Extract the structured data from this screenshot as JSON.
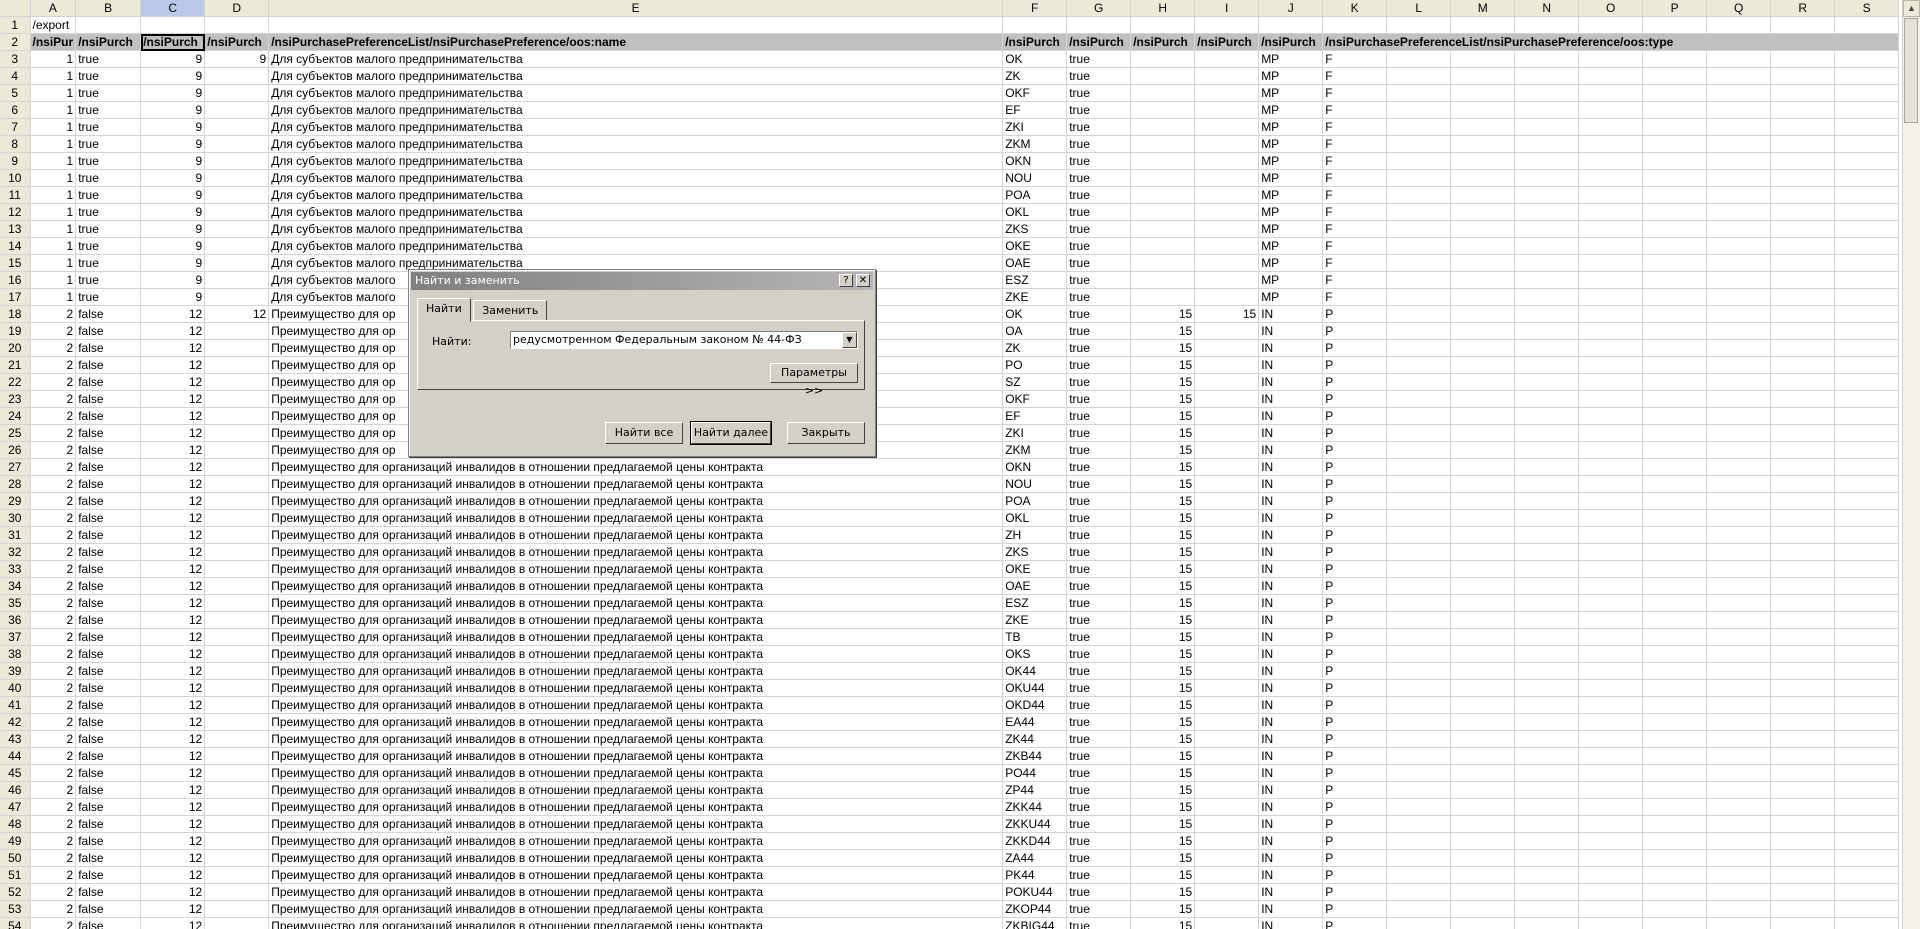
{
  "columns": [
    "A",
    "B",
    "C",
    "D",
    "E",
    "F",
    "G",
    "H",
    "I",
    "J",
    "K",
    "L",
    "M",
    "N",
    "O",
    "P",
    "Q",
    "R",
    "S"
  ],
  "active_column": "C",
  "row1": {
    "a": "/export"
  },
  "row2": {
    "a": "/nsiPur",
    "b": "/nsiPurch",
    "c": "/nsiPurch",
    "d": "/nsiPurch",
    "e": "/nsiPurchasePreferenceList/nsiPurchasePreference/oos:name",
    "f": "/nsiPurch",
    "g": "/nsiPurch",
    "h": "/nsiPurch",
    "i": "/nsiPurch",
    "j": "/nsiPurch",
    "k": "/nsiPurchasePreferenceList/nsiPurchasePreference/oos:type"
  },
  "text_mp": "Для субъектов малого предпринимательства",
  "text_mp_cut": "Для субъектов малого",
  "text_in": "Преимущество для организаций инвалидов в отношении предлагаемой цены контракта",
  "text_in_cut": "Преимущество для ор",
  "rows": [
    {
      "n": "3",
      "a": "1",
      "b": "true",
      "c": "9",
      "d": "9",
      "f": "OK",
      "g": "true",
      "h": "",
      "i": "",
      "j": "MP",
      "k": "F"
    },
    {
      "n": "4",
      "a": "1",
      "b": "true",
      "c": "9",
      "d": "",
      "f": "ZK",
      "g": "true",
      "h": "",
      "i": "",
      "j": "MP",
      "k": "F"
    },
    {
      "n": "5",
      "a": "1",
      "b": "true",
      "c": "9",
      "d": "",
      "f": "OKF",
      "g": "true",
      "h": "",
      "i": "",
      "j": "MP",
      "k": "F"
    },
    {
      "n": "6",
      "a": "1",
      "b": "true",
      "c": "9",
      "d": "",
      "f": "EF",
      "g": "true",
      "h": "",
      "i": "",
      "j": "MP",
      "k": "F"
    },
    {
      "n": "7",
      "a": "1",
      "b": "true",
      "c": "9",
      "d": "",
      "f": "ZKI",
      "g": "true",
      "h": "",
      "i": "",
      "j": "MP",
      "k": "F"
    },
    {
      "n": "8",
      "a": "1",
      "b": "true",
      "c": "9",
      "d": "",
      "f": "ZKM",
      "g": "true",
      "h": "",
      "i": "",
      "j": "MP",
      "k": "F"
    },
    {
      "n": "9",
      "a": "1",
      "b": "true",
      "c": "9",
      "d": "",
      "f": "OKN",
      "g": "true",
      "h": "",
      "i": "",
      "j": "MP",
      "k": "F"
    },
    {
      "n": "10",
      "a": "1",
      "b": "true",
      "c": "9",
      "d": "",
      "f": "NOU",
      "g": "true",
      "h": "",
      "i": "",
      "j": "MP",
      "k": "F"
    },
    {
      "n": "11",
      "a": "1",
      "b": "true",
      "c": "9",
      "d": "",
      "f": "POA",
      "g": "true",
      "h": "",
      "i": "",
      "j": "MP",
      "k": "F"
    },
    {
      "n": "12",
      "a": "1",
      "b": "true",
      "c": "9",
      "d": "",
      "f": "OKL",
      "g": "true",
      "h": "",
      "i": "",
      "j": "MP",
      "k": "F"
    },
    {
      "n": "13",
      "a": "1",
      "b": "true",
      "c": "9",
      "d": "",
      "f": "ZKS",
      "g": "true",
      "h": "",
      "i": "",
      "j": "MP",
      "k": "F"
    },
    {
      "n": "14",
      "a": "1",
      "b": "true",
      "c": "9",
      "d": "",
      "f": "OKE",
      "g": "true",
      "h": "",
      "i": "",
      "j": "MP",
      "k": "F"
    },
    {
      "n": "15",
      "a": "1",
      "b": "true",
      "c": "9",
      "d": "",
      "f": "OAE",
      "g": "true",
      "h": "",
      "i": "",
      "j": "MP",
      "k": "F"
    },
    {
      "n": "16",
      "a": "1",
      "b": "true",
      "c": "9",
      "d": "",
      "f": "ESZ",
      "g": "true",
      "h": "",
      "i": "",
      "j": "MP",
      "k": "F"
    },
    {
      "n": "17",
      "a": "1",
      "b": "true",
      "c": "9",
      "d": "",
      "f": "ZKE",
      "g": "true",
      "h": "",
      "i": "",
      "j": "MP",
      "k": "F"
    },
    {
      "n": "18",
      "a": "2",
      "b": "false",
      "c": "12",
      "d": "12",
      "f": "OK",
      "g": "true",
      "h": "15",
      "i": "15",
      "j": "IN",
      "k": "P"
    },
    {
      "n": "19",
      "a": "2",
      "b": "false",
      "c": "12",
      "d": "",
      "f": "OA",
      "g": "true",
      "h": "15",
      "i": "",
      "j": "IN",
      "k": "P"
    },
    {
      "n": "20",
      "a": "2",
      "b": "false",
      "c": "12",
      "d": "",
      "f": "ZK",
      "g": "true",
      "h": "15",
      "i": "",
      "j": "IN",
      "k": "P"
    },
    {
      "n": "21",
      "a": "2",
      "b": "false",
      "c": "12",
      "d": "",
      "f": "PO",
      "g": "true",
      "h": "15",
      "i": "",
      "j": "IN",
      "k": "P"
    },
    {
      "n": "22",
      "a": "2",
      "b": "false",
      "c": "12",
      "d": "",
      "f": "SZ",
      "g": "true",
      "h": "15",
      "i": "",
      "j": "IN",
      "k": "P"
    },
    {
      "n": "23",
      "a": "2",
      "b": "false",
      "c": "12",
      "d": "",
      "f": "OKF",
      "g": "true",
      "h": "15",
      "i": "",
      "j": "IN",
      "k": "P"
    },
    {
      "n": "24",
      "a": "2",
      "b": "false",
      "c": "12",
      "d": "",
      "f": "EF",
      "g": "true",
      "h": "15",
      "i": "",
      "j": "IN",
      "k": "P"
    },
    {
      "n": "25",
      "a": "2",
      "b": "false",
      "c": "12",
      "d": "",
      "f": "ZKI",
      "g": "true",
      "h": "15",
      "i": "",
      "j": "IN",
      "k": "P"
    },
    {
      "n": "26",
      "a": "2",
      "b": "false",
      "c": "12",
      "d": "",
      "f": "ZKM",
      "g": "true",
      "h": "15",
      "i": "",
      "j": "IN",
      "k": "P"
    },
    {
      "n": "27",
      "a": "2",
      "b": "false",
      "c": "12",
      "d": "",
      "f": "OKN",
      "g": "true",
      "h": "15",
      "i": "",
      "j": "IN",
      "k": "P"
    },
    {
      "n": "28",
      "a": "2",
      "b": "false",
      "c": "12",
      "d": "",
      "f": "NOU",
      "g": "true",
      "h": "15",
      "i": "",
      "j": "IN",
      "k": "P"
    },
    {
      "n": "29",
      "a": "2",
      "b": "false",
      "c": "12",
      "d": "",
      "f": "POA",
      "g": "true",
      "h": "15",
      "i": "",
      "j": "IN",
      "k": "P"
    },
    {
      "n": "30",
      "a": "2",
      "b": "false",
      "c": "12",
      "d": "",
      "f": "OKL",
      "g": "true",
      "h": "15",
      "i": "",
      "j": "IN",
      "k": "P"
    },
    {
      "n": "31",
      "a": "2",
      "b": "false",
      "c": "12",
      "d": "",
      "f": "ZH",
      "g": "true",
      "h": "15",
      "i": "",
      "j": "IN",
      "k": "P"
    },
    {
      "n": "32",
      "a": "2",
      "b": "false",
      "c": "12",
      "d": "",
      "f": "ZKS",
      "g": "true",
      "h": "15",
      "i": "",
      "j": "IN",
      "k": "P"
    },
    {
      "n": "33",
      "a": "2",
      "b": "false",
      "c": "12",
      "d": "",
      "f": "OKE",
      "g": "true",
      "h": "15",
      "i": "",
      "j": "IN",
      "k": "P"
    },
    {
      "n": "34",
      "a": "2",
      "b": "false",
      "c": "12",
      "d": "",
      "f": "OAE",
      "g": "true",
      "h": "15",
      "i": "",
      "j": "IN",
      "k": "P"
    },
    {
      "n": "35",
      "a": "2",
      "b": "false",
      "c": "12",
      "d": "",
      "f": "ESZ",
      "g": "true",
      "h": "15",
      "i": "",
      "j": "IN",
      "k": "P"
    },
    {
      "n": "36",
      "a": "2",
      "b": "false",
      "c": "12",
      "d": "",
      "f": "ZKE",
      "g": "true",
      "h": "15",
      "i": "",
      "j": "IN",
      "k": "P"
    },
    {
      "n": "37",
      "a": "2",
      "b": "false",
      "c": "12",
      "d": "",
      "f": "TB",
      "g": "true",
      "h": "15",
      "i": "",
      "j": "IN",
      "k": "P"
    },
    {
      "n": "38",
      "a": "2",
      "b": "false",
      "c": "12",
      "d": "",
      "f": "OKS",
      "g": "true",
      "h": "15",
      "i": "",
      "j": "IN",
      "k": "P"
    },
    {
      "n": "39",
      "a": "2",
      "b": "false",
      "c": "12",
      "d": "",
      "f": "OK44",
      "g": "true",
      "h": "15",
      "i": "",
      "j": "IN",
      "k": "P"
    },
    {
      "n": "40",
      "a": "2",
      "b": "false",
      "c": "12",
      "d": "",
      "f": "OKU44",
      "g": "true",
      "h": "15",
      "i": "",
      "j": "IN",
      "k": "P"
    },
    {
      "n": "41",
      "a": "2",
      "b": "false",
      "c": "12",
      "d": "",
      "f": "OKD44",
      "g": "true",
      "h": "15",
      "i": "",
      "j": "IN",
      "k": "P"
    },
    {
      "n": "42",
      "a": "2",
      "b": "false",
      "c": "12",
      "d": "",
      "f": "EA44",
      "g": "true",
      "h": "15",
      "i": "",
      "j": "IN",
      "k": "P"
    },
    {
      "n": "43",
      "a": "2",
      "b": "false",
      "c": "12",
      "d": "",
      "f": "ZK44",
      "g": "true",
      "h": "15",
      "i": "",
      "j": "IN",
      "k": "P"
    },
    {
      "n": "44",
      "a": "2",
      "b": "false",
      "c": "12",
      "d": "",
      "f": "ZKB44",
      "g": "true",
      "h": "15",
      "i": "",
      "j": "IN",
      "k": "P"
    },
    {
      "n": "45",
      "a": "2",
      "b": "false",
      "c": "12",
      "d": "",
      "f": "PO44",
      "g": "true",
      "h": "15",
      "i": "",
      "j": "IN",
      "k": "P"
    },
    {
      "n": "46",
      "a": "2",
      "b": "false",
      "c": "12",
      "d": "",
      "f": "ZP44",
      "g": "true",
      "h": "15",
      "i": "",
      "j": "IN",
      "k": "P"
    },
    {
      "n": "47",
      "a": "2",
      "b": "false",
      "c": "12",
      "d": "",
      "f": "ZKK44",
      "g": "true",
      "h": "15",
      "i": "",
      "j": "IN",
      "k": "P"
    },
    {
      "n": "48",
      "a": "2",
      "b": "false",
      "c": "12",
      "d": "",
      "f": "ZKKU44",
      "g": "true",
      "h": "15",
      "i": "",
      "j": "IN",
      "k": "P"
    },
    {
      "n": "49",
      "a": "2",
      "b": "false",
      "c": "12",
      "d": "",
      "f": "ZKKD44",
      "g": "true",
      "h": "15",
      "i": "",
      "j": "IN",
      "k": "P"
    },
    {
      "n": "50",
      "a": "2",
      "b": "false",
      "c": "12",
      "d": "",
      "f": "ZA44",
      "g": "true",
      "h": "15",
      "i": "",
      "j": "IN",
      "k": "P"
    },
    {
      "n": "51",
      "a": "2",
      "b": "false",
      "c": "12",
      "d": "",
      "f": "PK44",
      "g": "true",
      "h": "15",
      "i": "",
      "j": "IN",
      "k": "P"
    },
    {
      "n": "52",
      "a": "2",
      "b": "false",
      "c": "12",
      "d": "",
      "f": "POKU44",
      "g": "true",
      "h": "15",
      "i": "",
      "j": "IN",
      "k": "P"
    },
    {
      "n": "53",
      "a": "2",
      "b": "false",
      "c": "12",
      "d": "",
      "f": "ZKOP44",
      "g": "true",
      "h": "15",
      "i": "",
      "j": "IN",
      "k": "P"
    },
    {
      "n": "54",
      "a": "2",
      "b": "false",
      "c": "12",
      "d": "",
      "f": "ZKBIG44",
      "g": "true",
      "h": "15",
      "i": "",
      "j": "IN",
      "k": "P"
    }
  ],
  "dialog": {
    "title": "Найти и заменить",
    "help_glyph": "?",
    "close_glyph": "✕",
    "tab_find": "Найти",
    "tab_replace": "Заменить",
    "find_label": "Найти:",
    "find_value": "редусмотренном Федеральным законом № 44-ФЗ",
    "params_button": "Параметры >>",
    "find_all_button": "Найти все",
    "find_next_button": "Найти далее",
    "close_button": "Закрыть"
  }
}
